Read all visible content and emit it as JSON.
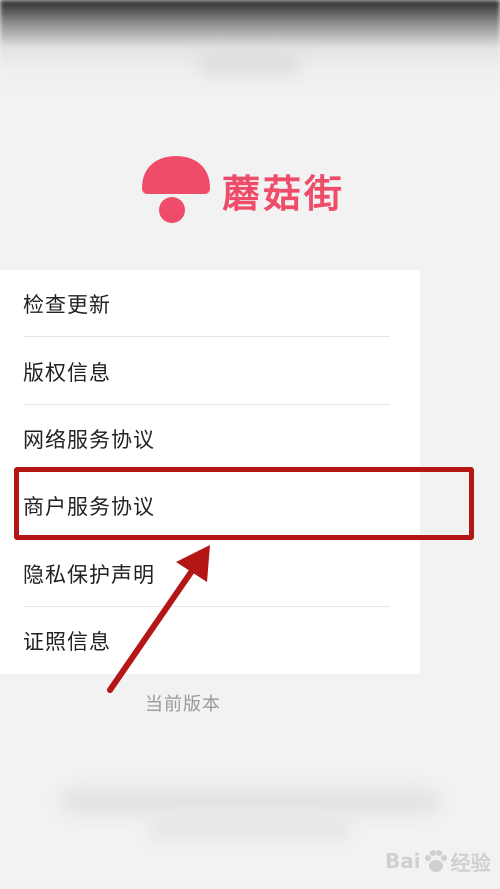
{
  "app": {
    "name": "蘑菇街",
    "brand_color": "#ef4c6a"
  },
  "menu": {
    "items": [
      {
        "label": "检查更新"
      },
      {
        "label": "版权信息"
      },
      {
        "label": "网络服务协议"
      },
      {
        "label": "商户服务协议",
        "highlighted": true
      },
      {
        "label": "隐私保护声明"
      },
      {
        "label": "证照信息"
      }
    ]
  },
  "version": {
    "label": "当前版本"
  },
  "annotation": {
    "highlight_color": "#b41515"
  },
  "watermark": {
    "text_left": "Bai",
    "text_right": "经验",
    "icon": "paw-icon"
  }
}
